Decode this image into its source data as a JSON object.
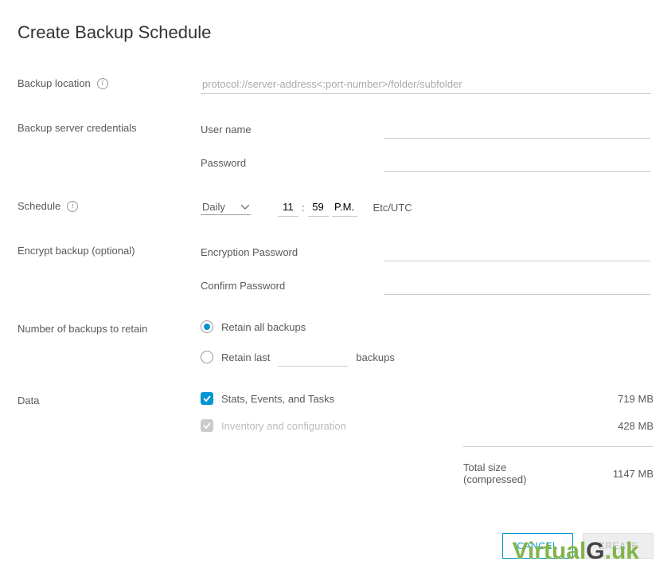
{
  "title": "Create Backup Schedule",
  "labels": {
    "backup_location": "Backup location",
    "backup_server_credentials": "Backup server credentials",
    "username": "User name",
    "password": "Password",
    "schedule": "Schedule",
    "encrypt_backup": "Encrypt backup (optional)",
    "encryption_password": "Encryption Password",
    "confirm_password": "Confirm Password",
    "number_of_backups": "Number of backups to retain",
    "retain_all": "Retain all backups",
    "retain_last": "Retain last",
    "backups_suffix": "backups",
    "data": "Data",
    "total": "Total size (compressed)"
  },
  "backup_location": {
    "placeholder": "protocol://server-address<:port-number>/folder/subfolder"
  },
  "schedule": {
    "frequency": "Daily",
    "hour": "11",
    "minute": "59",
    "ampm": "P.M.",
    "separator": ":",
    "timezone": "Etc/UTC"
  },
  "data_items": [
    {
      "label": "Stats, Events, and Tasks",
      "size": "719 MB",
      "checked": true,
      "disabled": false
    },
    {
      "label": "Inventory and configuration",
      "size": "428 MB",
      "checked": true,
      "disabled": true
    }
  ],
  "total_size": "1147 MB",
  "buttons": {
    "cancel": "CANCEL",
    "create": "CREATE"
  },
  "watermark": {
    "part1": "Virtual",
    "part2": "G",
    "part3": ".uk"
  }
}
